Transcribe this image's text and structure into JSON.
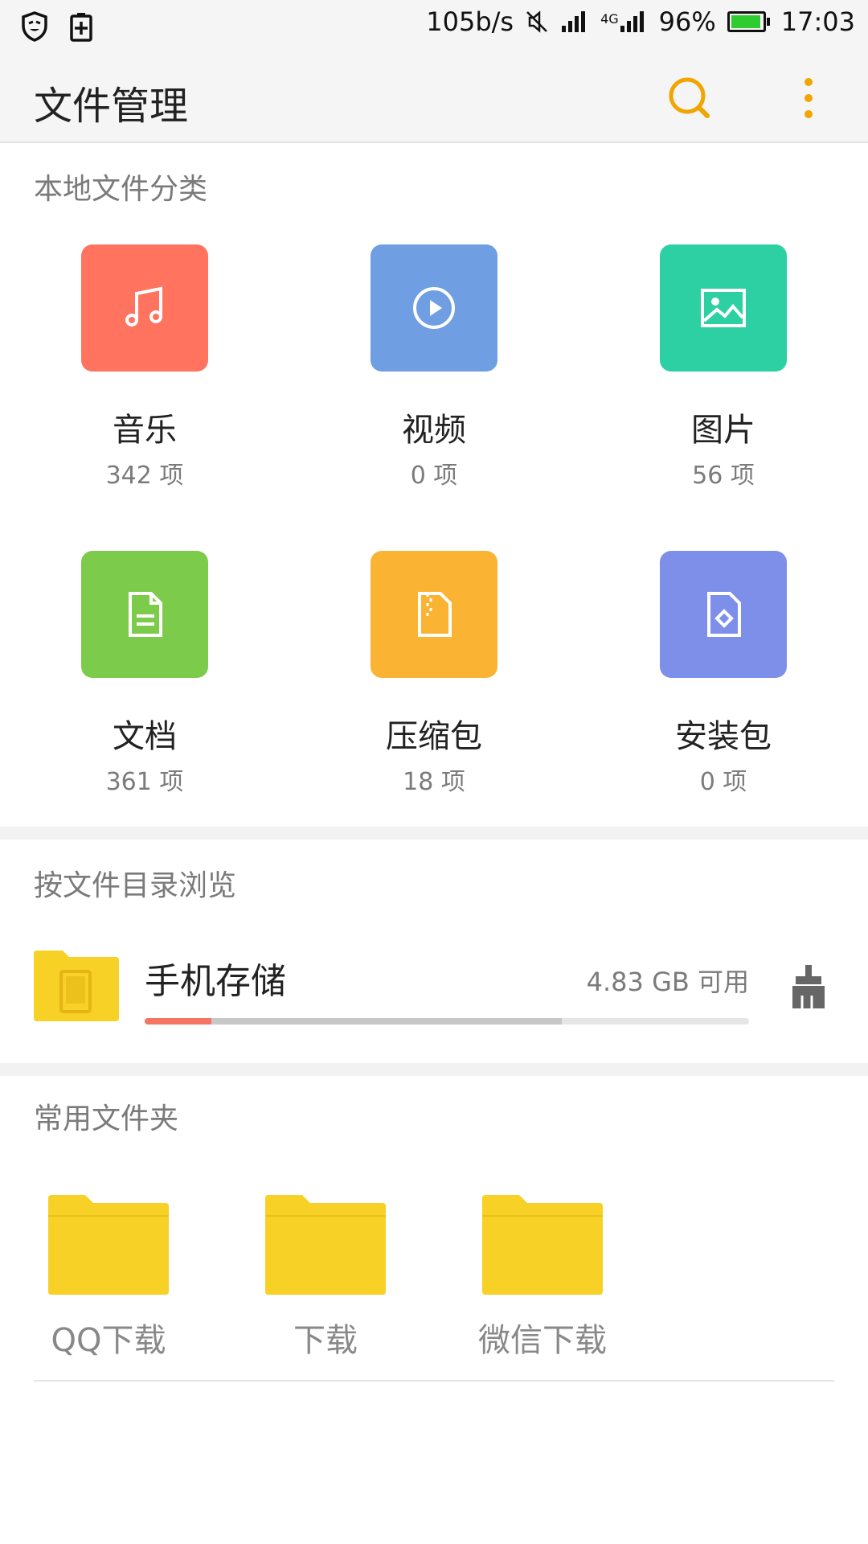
{
  "status_bar": {
    "net_speed": "105b/s",
    "network": "4G",
    "battery_percent": "96%",
    "battery_level": 0.96,
    "time": "17:03",
    "icons": [
      "shield-icon",
      "battery-saver-icon",
      "mute-icon",
      "signal-icon",
      "signal-4g-icon"
    ]
  },
  "app_bar": {
    "title": "文件管理",
    "accent_color": "#F0A500",
    "icons": [
      "search-icon",
      "more-vert-icon"
    ]
  },
  "categories_section": {
    "label": "本地文件分类",
    "items": [
      {
        "name": "音乐",
        "count": "342 项",
        "color": "#FF735F",
        "icon": "music-note-icon"
      },
      {
        "name": "视频",
        "count": "0 项",
        "color": "#6F9FE2",
        "icon": "play-circle-icon"
      },
      {
        "name": "图片",
        "count": "56 项",
        "color": "#2DD0A2",
        "icon": "image-icon"
      },
      {
        "name": "文档",
        "count": "361 项",
        "color": "#7DCB4B",
        "icon": "document-icon"
      },
      {
        "name": "压缩包",
        "count": "18 项",
        "color": "#FBB334",
        "icon": "archive-icon"
      },
      {
        "name": "安装包",
        "count": "0 项",
        "color": "#7E8FEA",
        "icon": "package-icon"
      }
    ]
  },
  "browse_section": {
    "label": "按文件目录浏览",
    "storage": {
      "name": "手机存储",
      "free": "4.83 GB 可用",
      "used_primary_fraction": 0.11,
      "used_total_fraction": 0.69,
      "icons": [
        "phone-storage-icon",
        "clean-brush-icon"
      ]
    }
  },
  "frequent_section": {
    "label": "常用文件夹",
    "folders": [
      {
        "label": "QQ下载"
      },
      {
        "label": "下载"
      },
      {
        "label": "微信下载"
      }
    ]
  }
}
